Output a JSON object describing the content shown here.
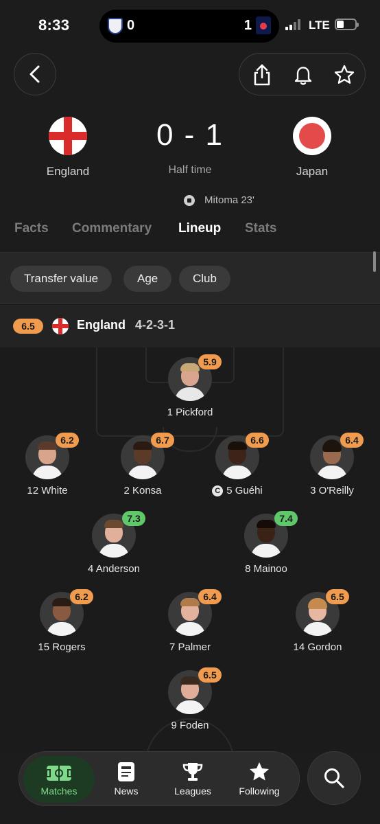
{
  "status_bar": {
    "time": "8:33",
    "home_score": "0",
    "away_score": "1",
    "network": "LTE"
  },
  "match": {
    "home_team": "England",
    "away_team": "Japan",
    "score": "0 - 1",
    "status": "Half time",
    "goal_event": "Mitoma 23'"
  },
  "tabs": [
    "Facts",
    "Commentary",
    "Lineup",
    "Stats"
  ],
  "active_tab": "Lineup",
  "filters": [
    "Transfer value",
    "Age",
    "Club"
  ],
  "lineup": {
    "team_rating": "6.5",
    "team_name": "England",
    "formation": "4-2-3-1",
    "players": [
      {
        "name": "1 Pickford",
        "rating": "5.9",
        "rating_color": "#f09b4e"
      },
      {
        "name": "12 White",
        "rating": "6.2",
        "rating_color": "#f09b4e"
      },
      {
        "name": "2 Konsa",
        "rating": "6.7",
        "rating_color": "#f09b4e"
      },
      {
        "name": "5 Guéhi",
        "rating": "6.6",
        "rating_color": "#f09b4e",
        "captain": "C"
      },
      {
        "name": "3 O'Reilly",
        "rating": "6.4",
        "rating_color": "#f09b4e"
      },
      {
        "name": "4 Anderson",
        "rating": "7.3",
        "rating_color": "#5fc86a"
      },
      {
        "name": "8 Mainoo",
        "rating": "7.4",
        "rating_color": "#5fc86a"
      },
      {
        "name": "15 Rogers",
        "rating": "6.2",
        "rating_color": "#f09b4e"
      },
      {
        "name": "7 Palmer",
        "rating": "6.4",
        "rating_color": "#f09b4e"
      },
      {
        "name": "14 Gordon",
        "rating": "6.5",
        "rating_color": "#f09b4e"
      },
      {
        "name": "9 Foden",
        "rating": "6.5",
        "rating_color": "#f09b4e"
      }
    ]
  },
  "bottom_nav": {
    "items": [
      "Matches",
      "News",
      "Leagues",
      "Following"
    ],
    "active": "Matches"
  },
  "colors": {
    "accent_green": "#5fc86a",
    "accent_orange": "#f09b4e",
    "background": "#1c1c1c"
  }
}
